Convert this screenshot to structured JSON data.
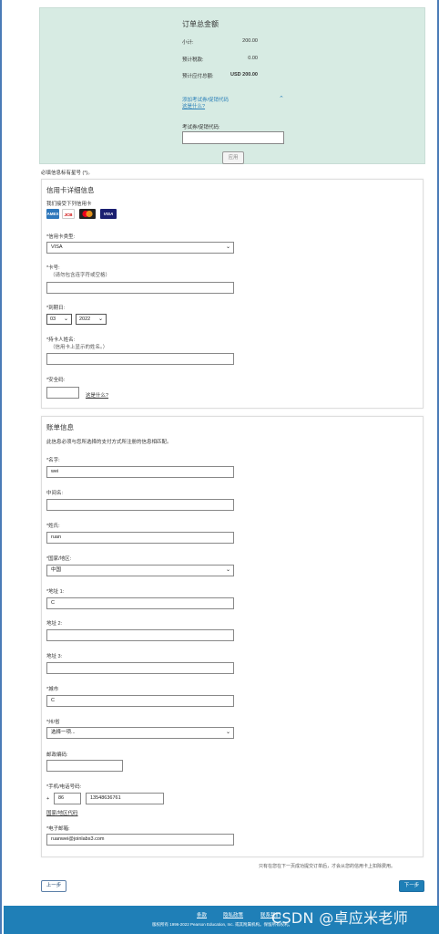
{
  "summary": {
    "title": "订单总金额",
    "subtotal_label": "小计:",
    "subtotal_value": "200.00",
    "tax_label": "预计税款:",
    "tax_value": "0.00",
    "total_label": "预计应付总额:",
    "total_value": "USD 200.00",
    "promo_link": "添加考试券/促销代码",
    "what_link": "这是什么?",
    "promo_label": "考试券/促销代码:",
    "apply_button": "应用"
  },
  "required_note": "必填信息标有星号 (*)。",
  "credit_card": {
    "heading": "信用卡详细信息",
    "accepted_label": "我们接受下列信用卡",
    "card_icons": [
      {
        "name": "amex",
        "label": "AMEX",
        "color": "#2e77bb"
      },
      {
        "name": "jcb",
        "label": "JCB",
        "color": "#ffffff"
      },
      {
        "name": "mastercard",
        "label": "",
        "color": "#222222"
      },
      {
        "name": "visa",
        "label": "VISA",
        "color": "#1a1f71"
      }
    ],
    "type_label": "*信用卡类型:",
    "type_value": "VISA",
    "number_label": "*卡号:",
    "number_hint": "（请勿包含连字符或空格）",
    "expiry_label": "*到期日:",
    "expiry_month": "03",
    "expiry_year": "2022",
    "holder_label": "*持卡人姓名:",
    "holder_hint": "（信用卡上显示的姓名。）",
    "cvv_label": "*安全码:",
    "cvv_link": "这是什么?"
  },
  "billing": {
    "heading": "账单信息",
    "note": "此信息必须与您所选择的支付方式所注册的信息相匹配。",
    "first_name_label": "*名字:",
    "first_name_value": "wei",
    "middle_name_label": "中间名:",
    "middle_name_value": "",
    "last_name_label": "*姓氏:",
    "last_name_value": "ruan",
    "country_label": "*国家/地区:",
    "country_value": "中国",
    "address1_label": "*地址 1:",
    "address1_value": "C",
    "address2_label": "地址 2:",
    "address2_value": "",
    "address3_label": "地址 3:",
    "address3_value": "",
    "city_label": "*城市",
    "city_value": "C",
    "province_label": "*州/省",
    "province_value": "选择一项...",
    "postal_label": "邮政编码:",
    "postal_value": "",
    "phone_label": "*手机/电话号码:",
    "phone_plus": "+",
    "phone_country_code": "86",
    "phone_number": "13548636761",
    "country_code_link": "国家/地区代码",
    "email_label": "*电子邮箱:",
    "email_value": "ruanwei@joinlabs3.com"
  },
  "footer_note": "只有在您在下一页成功提交订单后，才会从您的信用卡上扣除费用。",
  "nav": {
    "prev": "上一步",
    "next": "下一步"
  },
  "footer": {
    "links": [
      "条款",
      "隐私政策",
      "联系我们"
    ],
    "copyright": "版权所有 1996-2022 Pearson Education, Inc. 或其附属机构。保留所有权利。",
    "watermark": "CSDN @卓应米老师"
  }
}
